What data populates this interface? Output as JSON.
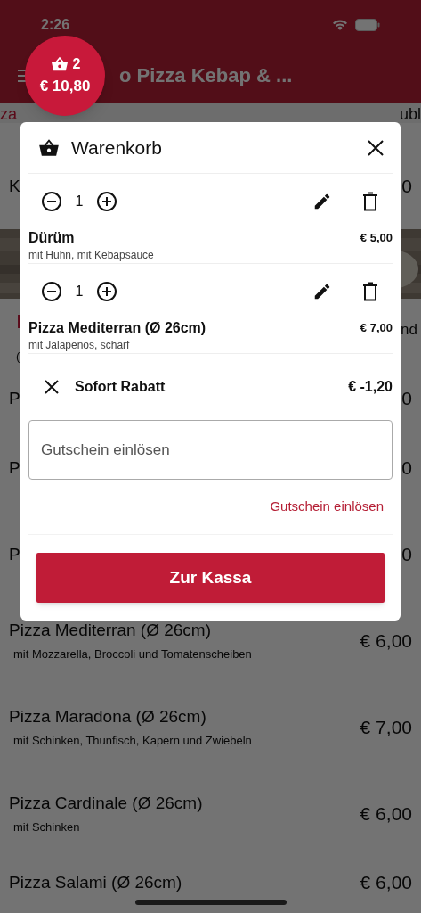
{
  "status_bar": {
    "time": "2:26"
  },
  "header": {
    "title": "o Pizza Kebap & ..."
  },
  "cart_badge": {
    "count": "2",
    "total": "€ 10,80"
  },
  "tabs": {
    "left": "za",
    "right": "ubl"
  },
  "background_rows": [
    {
      "kind": "item",
      "title": "K",
      "price": "0"
    },
    {
      "kind": "picture"
    },
    {
      "kind": "section",
      "title": "I",
      "lines": [
        "("
      ],
      "price": "nd"
    },
    {
      "kind": "compact",
      "title": "P",
      "price": "0"
    },
    {
      "kind": "item",
      "title": "P",
      "price": "0"
    },
    {
      "kind": "item",
      "title": "P",
      "price": "0"
    },
    {
      "kind": "item",
      "title": "Pizza Mediterran (Ø 26cm)",
      "subtitle": "mit Mozzarella, Broccoli und Tomatenscheiben",
      "price": "€ 6,00"
    },
    {
      "kind": "item",
      "title": "Pizza Maradona (Ø 26cm)",
      "subtitle": "mit Schinken, Thunfisch, Kapern und Zwiebeln",
      "price": "€ 7,00"
    },
    {
      "kind": "item",
      "title": "Pizza Cardinale (Ø 26cm)",
      "subtitle": "mit Schinken",
      "price": "€ 6,00"
    },
    {
      "kind": "compact",
      "title": "Pizza Salami (Ø 26cm)",
      "price": "€ 6,00"
    }
  ],
  "cart": {
    "title": "Warenkorb",
    "items": [
      {
        "quantity": "1",
        "name": "Dürüm",
        "options": "mit Huhn, mit Kebapsauce",
        "price": "€ 5,00"
      },
      {
        "quantity": "1",
        "name": "Pizza Mediterran (Ø 26cm)",
        "options": "mit Jalapenos, scharf",
        "price": "€ 7,00"
      }
    ],
    "discount": {
      "label": "Sofort Rabatt",
      "amount": "€ -1,20"
    },
    "voucher": {
      "placeholder": "Gutschein einlösen",
      "link": "Gutschein einlösen"
    },
    "checkout": "Zur Kassa"
  }
}
